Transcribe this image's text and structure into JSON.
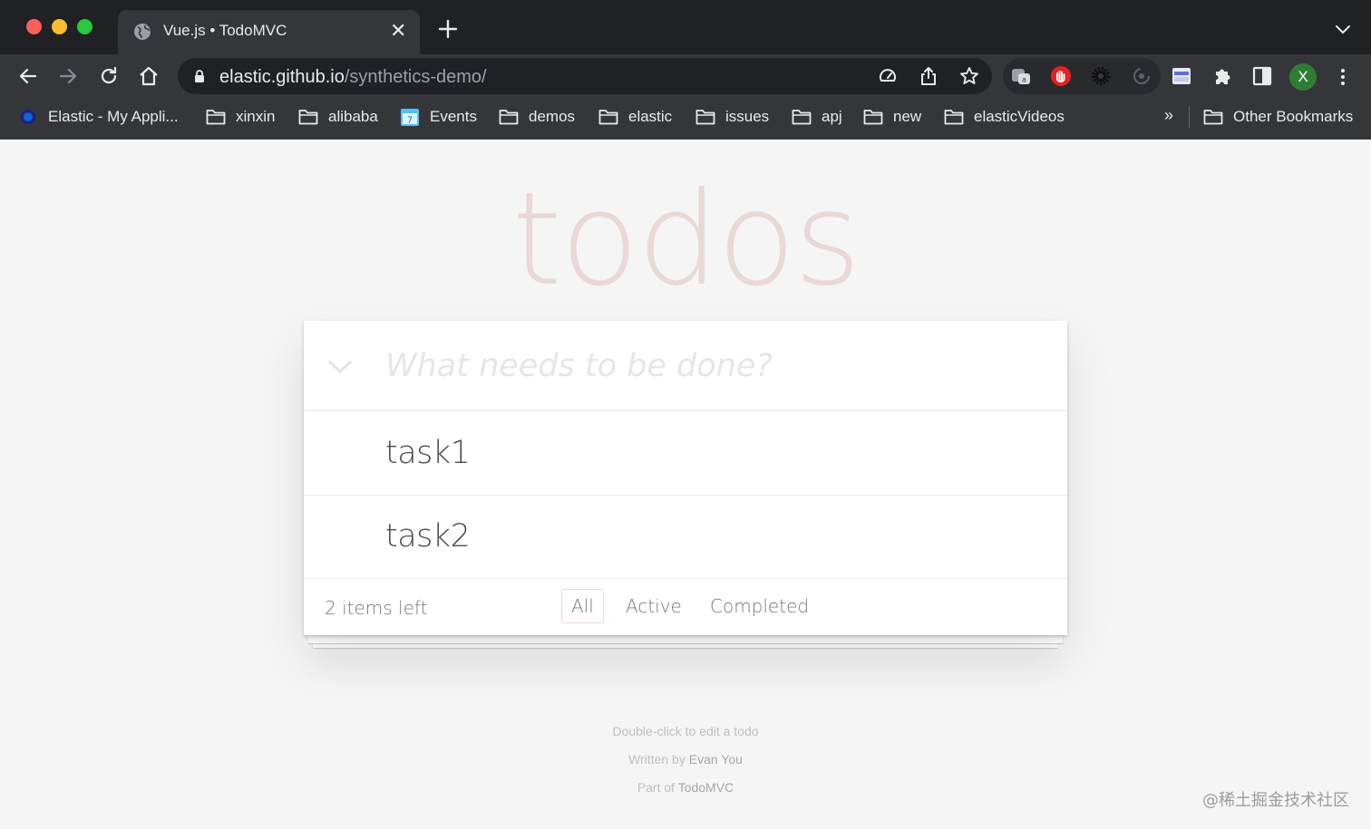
{
  "browser": {
    "tab": {
      "title": "Vue.js • TodoMVC",
      "close_glyph": "✕"
    },
    "url": {
      "host": "elastic.github.io",
      "path": "/synthetics-demo/"
    },
    "profile_initial": "X",
    "bookmarks": [
      {
        "label": "Elastic - My Appli...",
        "icon": "elastic-logo-icon"
      },
      {
        "label": "xinxin",
        "icon": "folder-icon"
      },
      {
        "label": "alibaba",
        "icon": "folder-icon"
      },
      {
        "label": "Events",
        "icon": "calendar-icon"
      },
      {
        "label": "demos",
        "icon": "folder-icon"
      },
      {
        "label": "elastic",
        "icon": "folder-icon"
      },
      {
        "label": "issues",
        "icon": "folder-icon"
      },
      {
        "label": "apj",
        "icon": "folder-icon"
      },
      {
        "label": "new",
        "icon": "folder-icon"
      },
      {
        "label": "elasticVideos",
        "icon": "folder-icon"
      }
    ],
    "more_bookmarks_glyph": "»",
    "other_bookmarks": "Other Bookmarks",
    "colors": {
      "tabstrip": "#202124",
      "toolbar": "#35363a",
      "avatar": "#2e7d32",
      "red_extension": "#e8201f"
    }
  },
  "app": {
    "title": "todos",
    "new_todo_placeholder": "What needs to be done?",
    "todos": [
      {
        "title": "task1",
        "completed": false
      },
      {
        "title": "task2",
        "completed": false
      }
    ],
    "footer": {
      "count_text": "2 items left",
      "filters": [
        {
          "label": "All",
          "selected": true
        },
        {
          "label": "Active",
          "selected": false
        },
        {
          "label": "Completed",
          "selected": false
        }
      ]
    },
    "info": {
      "line1": "Double-click to edit a todo",
      "line2_prefix": "Written by ",
      "line2_link": "Evan You",
      "line3_prefix": "Part of ",
      "line3_link": "TodoMVC"
    },
    "colors": {
      "title": "#af2f2f",
      "text": "#4d4d4d",
      "background": "#f5f5f5"
    }
  },
  "watermark": "@稀土掘金技术社区"
}
